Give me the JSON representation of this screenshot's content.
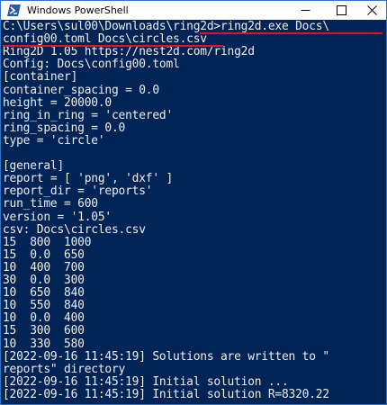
{
  "window": {
    "title": "Windows PowerShell",
    "accent": "#2b76c6",
    "background": "#012456",
    "text_color": "#eeedf0",
    "underline_color": "#e81123",
    "icons": {
      "app": "powershell-icon",
      "minimize": "minimize-icon",
      "maximize": "maximize-icon",
      "close": "close-icon"
    }
  },
  "console": {
    "lines": [
      "C:\\Users\\sul00\\Downloads\\ring2d>ring2d.exe Docs\\",
      "config00.toml Docs\\circles.csv",
      "Ring2D 1.05 https://nest2d.com/ring2d",
      "Config: Docs\\config00.toml",
      "[container]",
      "container_spacing = 0.0",
      "height = 20000.0",
      "ring_in_ring = 'centered'",
      "ring_spacing = 0.0",
      "type = 'circle'",
      "",
      "[general]",
      "report = [ 'png', 'dxf' ]",
      "report_dir = 'reports'",
      "run_time = 600",
      "version = '1.05'",
      "csv: Docs\\circles.csv",
      "15  800  1000",
      "15  0.0  650",
      "10  400  700",
      "30  0.0  300",
      "10  650  840",
      "10  550  840",
      "10  0.0  400",
      "15  300  600",
      "10  330  580",
      "[2022-09-16 11:45:19] Solutions are written to \"",
      "reports\" directory",
      "[2022-09-16 11:45:19] Initial solution ...",
      "[2022-09-16 11:45:19] Initial solution R=8320.22"
    ]
  }
}
